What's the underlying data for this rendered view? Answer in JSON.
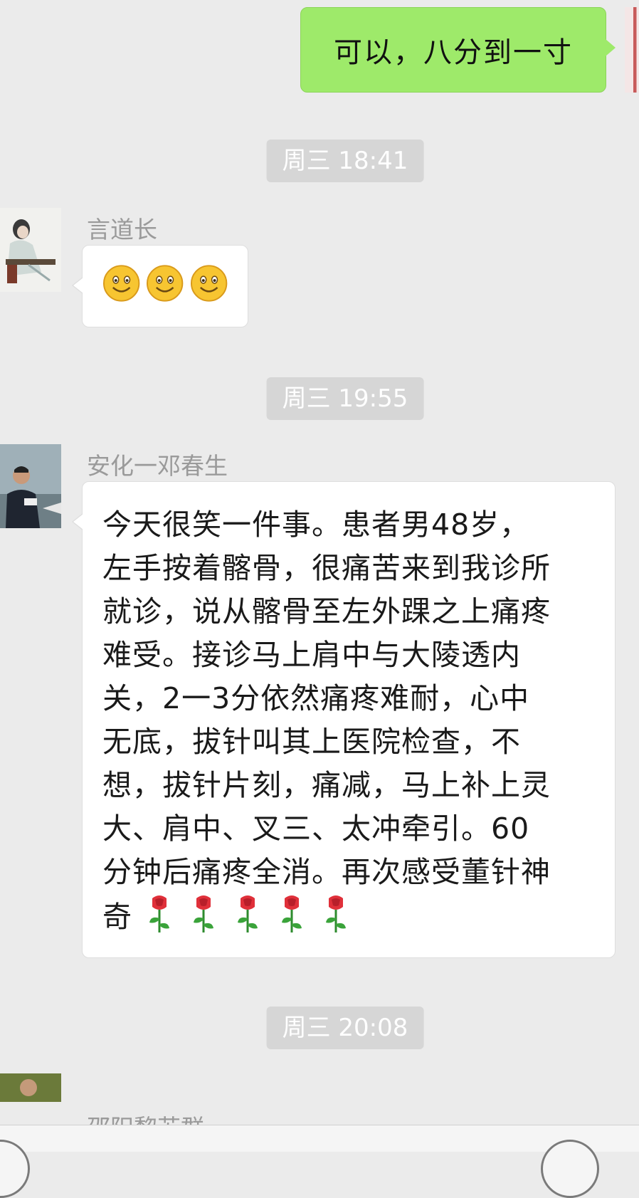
{
  "messages": {
    "outgoing_1": "可以，八分到一寸",
    "time_1": "周三 18:41",
    "sender_1": "言道长",
    "time_2": "周三 19:55",
    "sender_2": "安化一邓春生",
    "body_2": "今天很笑一件事。患者男48岁，\n左手按着髂骨，很痛苦来到我诊所\n就诊，说从髂骨至左外踝之上痛疼\n难受。接诊马上肩中与大陵透内\n关，2一3分依然痛疼难耐，心中\n无底，拔针叫其上医院检查，不\n想，拔针片刻，痛减，马上补上灵\n大、肩中、叉三、太冲牵引。60\n分钟后痛疼全消。再次感受董针神\n奇",
    "time_3": "周三 20:08",
    "sender_3_partial": "邵阳黎苏群"
  },
  "icons": {
    "emoji": "smile-emoji",
    "rose": "rose-emoji"
  },
  "colors": {
    "background": "#ebebeb",
    "outgoing_bubble": "#9eea6a",
    "incoming_bubble": "#ffffff",
    "time_pill": "#d6d6d6"
  }
}
